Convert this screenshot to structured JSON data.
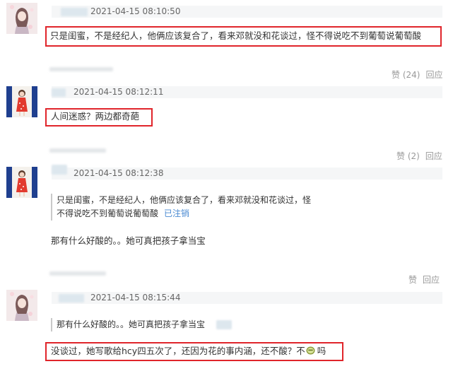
{
  "comments": [
    {
      "timestamp": "2021-04-15 08:10:50",
      "text": "只是闺蜜，不是经纪人，他俩应该复合了，看来邓就没和花谈过，怪不得说吃不到葡萄说葡萄酸",
      "highlighted": true,
      "like_label": "赞 (24)",
      "reply_label": "回应"
    },
    {
      "timestamp": "2021-04-15 08:12:11",
      "text": "人间迷惑？两边都奇葩",
      "highlighted": true,
      "like_label": "赞 (2)",
      "reply_label": "回应"
    },
    {
      "timestamp": "2021-04-15 08:12:38",
      "quote_line1": "只是闺蜜，不是经纪人，他俩应该复合了，看来邓就没和花谈过，怪",
      "quote_line2": "不得说吃不到葡萄说葡萄酸",
      "quote_author_status": "已注销",
      "text": "那有什么好酸的。。她可真把孩子拿当宝",
      "highlighted": false,
      "like_label": "赞",
      "reply_label": "回应"
    },
    {
      "timestamp": "2021-04-15 08:15:44",
      "quote_line1": "那有什么好酸的。。她可真把孩子拿当宝",
      "text": "没谈过，她写歌给hcy四五次了，还因为花的事内涵，还不酸？不",
      "text_tail": "吗",
      "highlighted": true
    }
  ],
  "colors": {
    "highlight_border": "#e0252b",
    "link": "#4a8ad2",
    "muted_text": "#999999",
    "meta_strip": "#f5f6f7"
  },
  "icons": {
    "emoji": "emoji-face-icon"
  }
}
